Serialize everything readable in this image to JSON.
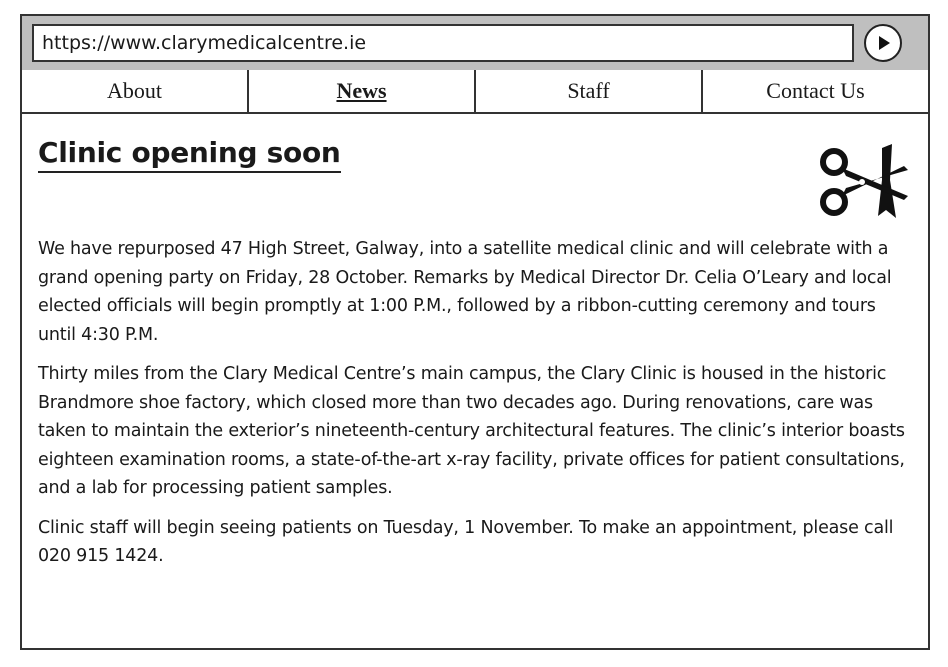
{
  "browser": {
    "url": "https://www.clarymedicalcentre.ie",
    "go_icon": "play-circle-icon"
  },
  "nav": {
    "tabs": [
      {
        "label": "About",
        "active": false
      },
      {
        "label": "News",
        "active": true
      },
      {
        "label": "Staff",
        "active": false
      },
      {
        "label": "Contact Us",
        "active": false
      }
    ]
  },
  "article": {
    "title": "Clinic opening soon",
    "icon": "scissors-cutting-ribbon-icon",
    "paragraphs": [
      "We have repurposed 47 High Street, Galway, into a satellite medical clinic and will celebrate with a grand opening party on Friday, 28 October. Remarks by Medical Director Dr. Celia O’Leary and local elected officials will begin promptly at 1:00 P.M., followed by a ribbon-cutting ceremony and tours until 4:30 P.M.",
      "Thirty miles from the Clary Medical Centre’s main campus, the Clary Clinic is housed in the historic Brandmore shoe factory, which closed more than two decades ago. During renovations, care was taken to maintain the exterior’s nineteenth-century architectural features. The clinic’s interior boasts eighteen examination rooms, a state-of-the-art x-ray facility, private offices for patient consultations, and a lab for processing patient samples.",
      "Clinic staff will begin seeing patients on Tuesday, 1 November. To make an appointment, please call 020 915 1424."
    ]
  }
}
